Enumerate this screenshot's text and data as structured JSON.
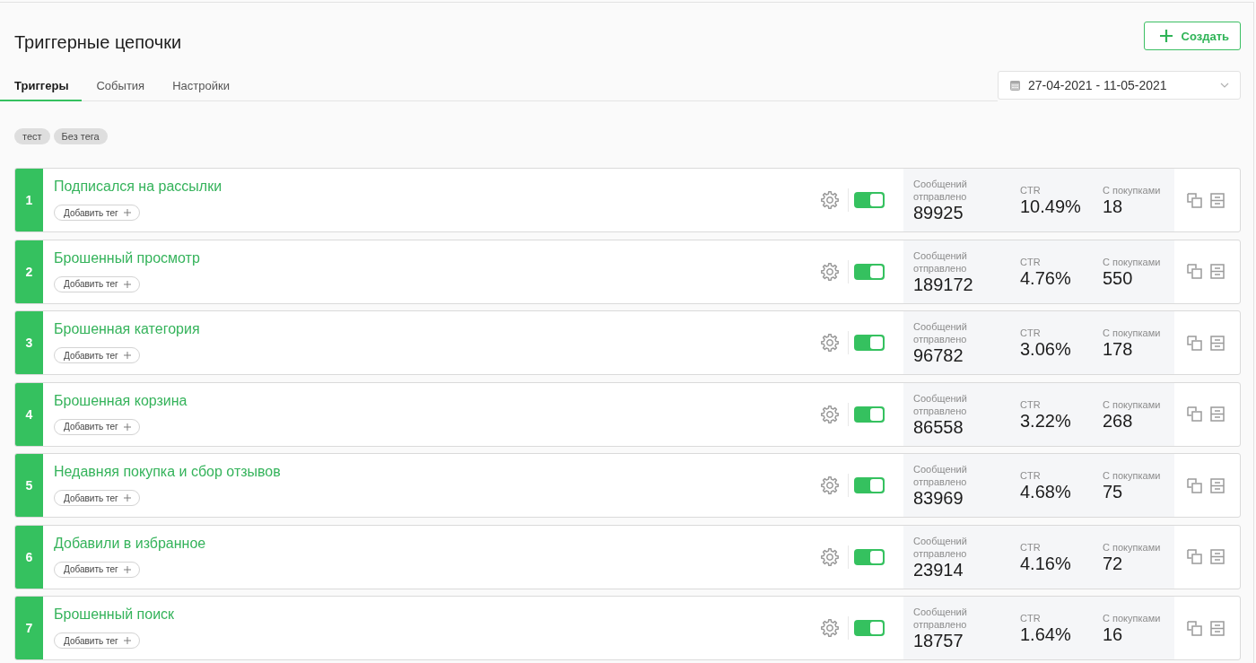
{
  "header": {
    "title": "Триггерные цепочки",
    "create_button": {
      "label": "Создать"
    }
  },
  "tabs": [
    {
      "label": "Триггеры",
      "selected": true
    },
    {
      "label": "События",
      "selected": false
    },
    {
      "label": "Настройки",
      "selected": false
    }
  ],
  "date_range": {
    "value": "27-04-2021 - 11-05-2021"
  },
  "tag_filters": [
    {
      "label": "тест"
    },
    {
      "label": "Без тега"
    }
  ],
  "triggers": [
    {
      "number": "1",
      "name": "Подписался на рассылки",
      "add_tag_label": "Добавить тег",
      "enabled": true,
      "stats": [
        {
          "label": "Сообщений отправлено",
          "value": "89925"
        },
        {
          "label": "CTR",
          "value": "10.49%"
        },
        {
          "label": "С покупками",
          "value": "18"
        }
      ]
    },
    {
      "number": "2",
      "name": "Брошенный просмотр",
      "add_tag_label": "Добавить тег",
      "enabled": true,
      "stats": [
        {
          "label": "Сообщений отправлено",
          "value": "189172"
        },
        {
          "label": "CTR",
          "value": "4.76%"
        },
        {
          "label": "С покупками",
          "value": "550"
        }
      ]
    },
    {
      "number": "3",
      "name": "Брошенная категория",
      "add_tag_label": "Добавить тег",
      "enabled": true,
      "stats": [
        {
          "label": "Сообщений отправлено",
          "value": "96782"
        },
        {
          "label": "CTR",
          "value": "3.06%"
        },
        {
          "label": "С покупками",
          "value": "178"
        }
      ]
    },
    {
      "number": "4",
      "name": "Брошенная корзина",
      "add_tag_label": "Добавить тег",
      "enabled": true,
      "stats": [
        {
          "label": "Сообщений отправлено",
          "value": "86558"
        },
        {
          "label": "CTR",
          "value": "3.22%"
        },
        {
          "label": "С покупками",
          "value": "268"
        }
      ]
    },
    {
      "number": "5",
      "name": "Недавняя покупка и сбор отзывов",
      "add_tag_label": "Добавить тег",
      "enabled": true,
      "stats": [
        {
          "label": "Сообщений отправлено",
          "value": "83969"
        },
        {
          "label": "CTR",
          "value": "4.68%"
        },
        {
          "label": "С покупками",
          "value": "75"
        }
      ]
    },
    {
      "number": "6",
      "name": "Добавили в избранное",
      "add_tag_label": "Добавить тег",
      "enabled": true,
      "stats": [
        {
          "label": "Сообщений отправлено",
          "value": "23914"
        },
        {
          "label": "CTR",
          "value": "4.16%"
        },
        {
          "label": "С покупками",
          "value": "72"
        }
      ]
    },
    {
      "number": "7",
      "name": "Брошенный поиск",
      "add_tag_label": "Добавить тег",
      "enabled": true,
      "stats": [
        {
          "label": "Сообщений отправлено",
          "value": "18757"
        },
        {
          "label": "CTR",
          "value": "1.64%"
        },
        {
          "label": "С покупками",
          "value": "16"
        }
      ]
    }
  ]
}
